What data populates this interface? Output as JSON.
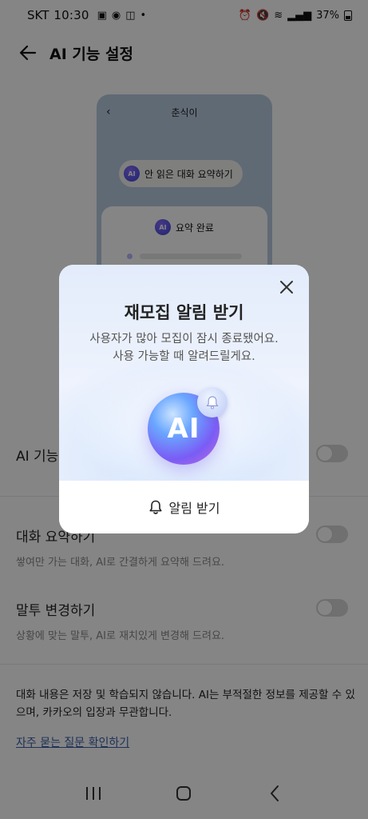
{
  "status_bar": {
    "carrier": "SKT",
    "time": "10:30",
    "battery": "37%"
  },
  "app_bar": {
    "title": "AI 기능 설정"
  },
  "preview": {
    "chat_name": "춘식이",
    "summary_button": "안 읽은 대화 요약하기",
    "ai_badge": "AI",
    "sheet_title": "요약 완료"
  },
  "settings": [
    {
      "name": "AI 기능",
      "desc": "",
      "enabled": false
    },
    {
      "name": "대화 요약하기",
      "desc": "쌓여만 가는 대화, AI로 간결하게 요약해 드려요.",
      "enabled": false
    },
    {
      "name": "말투 변경하기",
      "desc": "상황에 맞는 말투, AI로 재치있게 변경해 드려요.",
      "enabled": false
    }
  ],
  "notice": "대화 내용은 저장 및 학습되지 않습니다. AI는 부적절한 정보를 제공할 수 있으며, 카카오의 입장과 무관합니다.",
  "faq_link": "자주 묻는 질문 확인하기",
  "dialog": {
    "title": "재모집 알림 받기",
    "body_line1": "사용자가 많아 모집이 잠시 종료됐어요.",
    "body_line2": "사용 가능할 때 알려드릴게요.",
    "orb_label": "AI",
    "action_label": "알림 받기"
  },
  "icons": {
    "back": "arrow-left-icon",
    "close": "close-icon",
    "bell": "bell-icon"
  }
}
